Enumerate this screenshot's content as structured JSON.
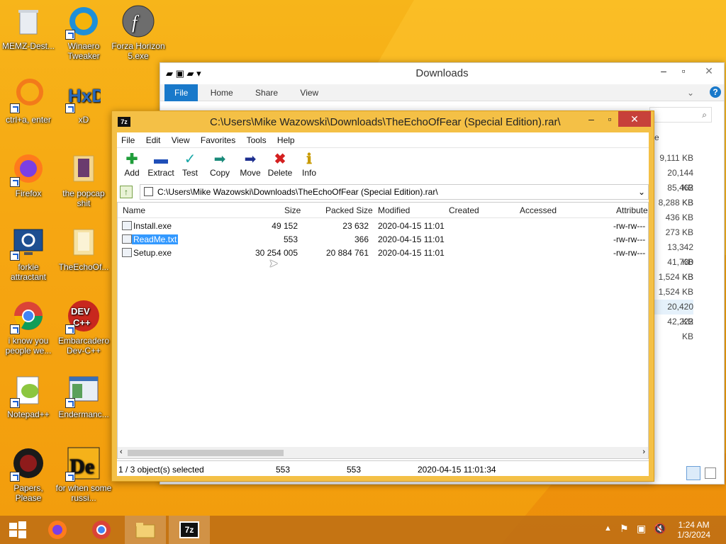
{
  "desktop": {
    "icons": [
      {
        "label": "MEMZ-Dest...",
        "icon": "recycle-bin-icon"
      },
      {
        "label": "Winaero Tweaker",
        "icon": "winaero-icon"
      },
      {
        "label": "Forza Horizon 5.exe",
        "icon": "flash-icon"
      },
      {
        "label": "ctrl+a, enter",
        "icon": "orange-ring-icon"
      },
      {
        "label": "xD",
        "icon": "hxd-icon"
      },
      {
        "label": "Firefox",
        "icon": "firefox-icon"
      },
      {
        "label": "the popcap shit",
        "icon": "folder-icon"
      },
      {
        "label": "forkie attractant",
        "icon": "monitor-gear-icon"
      },
      {
        "label": "TheEchoOf...",
        "icon": "folder-icon"
      },
      {
        "label": "i know you people we...",
        "icon": "chrome-icon"
      },
      {
        "label": "Embarcadero Dev-C++",
        "icon": "devcpp-icon"
      },
      {
        "label": "Notepad++",
        "icon": "notepadpp-icon"
      },
      {
        "label": "Endermanc...",
        "icon": "window-app-icon"
      },
      {
        "label": "Papers, Please",
        "icon": "papers-please-icon"
      },
      {
        "label": "for when some russi...",
        "icon": "de-icon"
      }
    ]
  },
  "explorer": {
    "title": "Downloads",
    "ribbon_tabs": [
      "File",
      "Home",
      "Share",
      "View"
    ],
    "sizes": [
      "9,111 KB",
      "20,144 KB",
      "85,462 KB",
      "8,288 KB",
      "436 KB",
      "273 KB",
      "13,342 KB",
      "41,730 KB",
      "1,524 KB",
      "1,524 KB",
      "20,420 KB",
      "42,222 KB"
    ],
    "col_partial": "e"
  },
  "sevenzip": {
    "title": "C:\\Users\\Mike Wazowski\\Downloads\\TheEchoOfFear (Special Edition).rar\\",
    "menu": [
      "File",
      "Edit",
      "View",
      "Favorites",
      "Tools",
      "Help"
    ],
    "tools": [
      {
        "label": "Add",
        "icon": "add-icon"
      },
      {
        "label": "Extract",
        "icon": "extract-icon"
      },
      {
        "label": "Test",
        "icon": "test-icon"
      },
      {
        "label": "Copy",
        "icon": "copy-icon"
      },
      {
        "label": "Move",
        "icon": "move-icon"
      },
      {
        "label": "Delete",
        "icon": "delete-icon"
      },
      {
        "label": "Info",
        "icon": "info-icon"
      }
    ],
    "address": "C:\\Users\\Mike Wazowski\\Downloads\\TheEchoOfFear (Special Edition).rar\\",
    "columns": [
      "Name",
      "Size",
      "Packed Size",
      "Modified",
      "Created",
      "Accessed",
      "Attribute"
    ],
    "files": [
      {
        "name": "Install.exe",
        "size": "49 152",
        "packed": "23 632",
        "modified": "2020-04-15 11:01",
        "attr": "-rw-rw---"
      },
      {
        "name": "ReadMe.txt",
        "size": "553",
        "packed": "366",
        "modified": "2020-04-15 11:01",
        "attr": "-rw-rw---",
        "selected": true
      },
      {
        "name": "Setup.exe",
        "size": "30 254 005",
        "packed": "20 884 761",
        "modified": "2020-04-15 11:01",
        "attr": "-rw-rw---"
      }
    ],
    "status": {
      "selected": "1 / 3 object(s) selected",
      "size": "553",
      "packed": "553",
      "modified": "2020-04-15 11:01:34"
    }
  },
  "taskbar": {
    "time": "1:24 AM",
    "date": "1/3/2024"
  }
}
